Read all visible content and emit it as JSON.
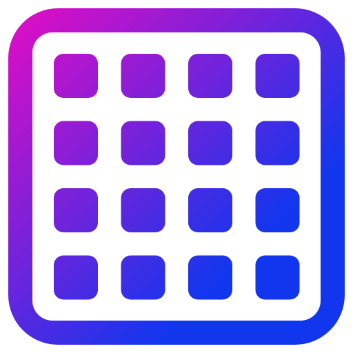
{
  "icon": {
    "name": "grid-icon",
    "rows": 4,
    "columns": 4,
    "gradient": {
      "start_color": "#E40CC4",
      "end_color": "#1236EE"
    }
  }
}
